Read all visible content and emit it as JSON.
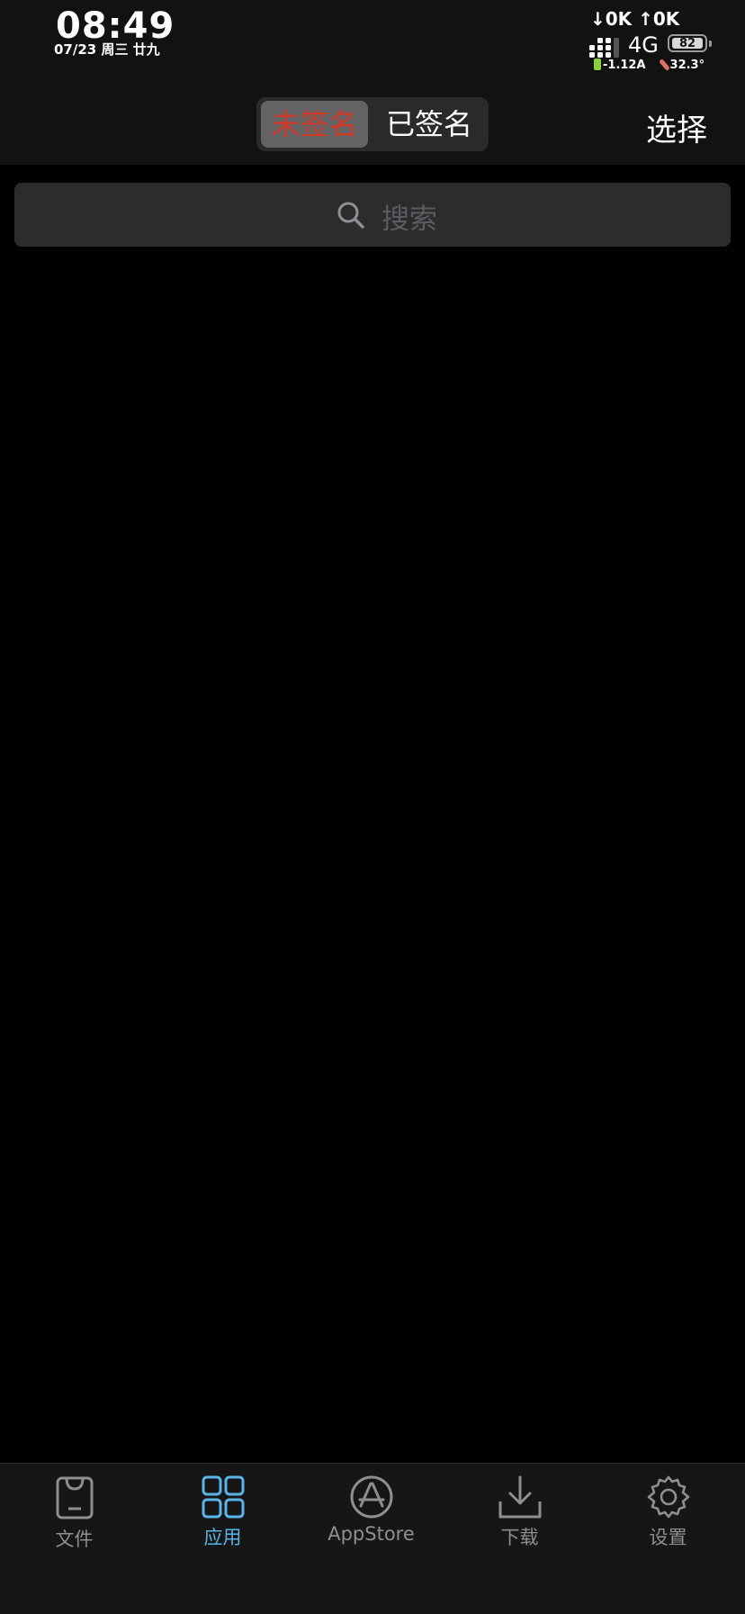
{
  "status_bar": {
    "time": "08:49",
    "date": "07/23 周三 廿九",
    "net_speed": "↓0K ↑0K",
    "network_type": "4G",
    "battery_level": "82",
    "current": "-1.12A",
    "temperature": "32.3°"
  },
  "nav": {
    "segments": [
      "未签名",
      "已签名"
    ],
    "selected_segment": "未签名",
    "select_label": "选择"
  },
  "search": {
    "placeholder": "搜索"
  },
  "tabs": [
    {
      "label": "文件",
      "icon": "file-bag-icon"
    },
    {
      "label": "应用",
      "icon": "apps-grid-icon"
    },
    {
      "label": "AppStore",
      "icon": "app-store-icon"
    },
    {
      "label": "下载",
      "icon": "download-icon"
    },
    {
      "label": "设置",
      "icon": "gear-icon"
    }
  ],
  "active_tab": "应用",
  "colors": {
    "accent": "#5ab4e8",
    "segment_active_text": "#d03a28",
    "background": "#000000"
  }
}
